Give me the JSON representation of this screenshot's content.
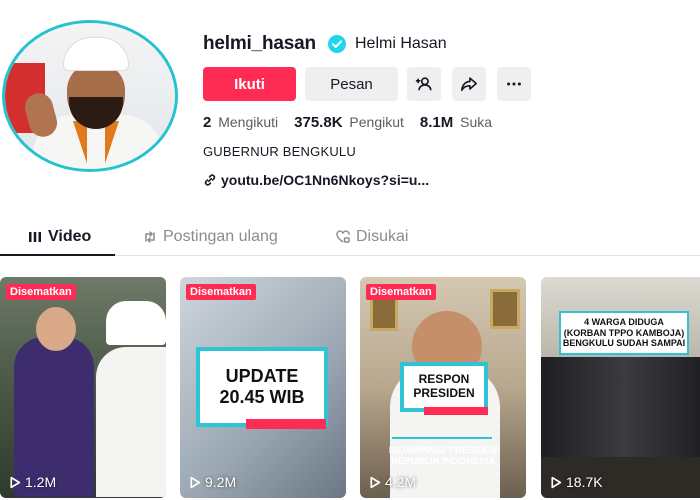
{
  "profile": {
    "username": "helmi_hasan",
    "nickname": "Helmi Hasan",
    "follow_label": "Ikuti",
    "message_label": "Pesan",
    "stats": [
      {
        "value": "2",
        "label": "Mengikuti"
      },
      {
        "value": "375.8K",
        "label": "Pengikut"
      },
      {
        "value": "8.1M",
        "label": "Suka"
      }
    ],
    "bio": "GUBERNUR BENGKULU",
    "link": "youtu.be/OC1Nn6Nkoys?si=u..."
  },
  "tabs": [
    {
      "label": "Video",
      "icon": "grid-icon",
      "active": true
    },
    {
      "label": "Postingan ulang",
      "icon": "repost-icon",
      "active": false
    },
    {
      "label": "Disukai",
      "icon": "heart-icon",
      "active": false
    }
  ],
  "videos": [
    {
      "pinned_label": "Disematkan",
      "views": "1.2M"
    },
    {
      "pinned_label": "Disematkan",
      "views": "9.2M",
      "overlay": "UPDATE\n20.45 WIB"
    },
    {
      "pinned_label": "Disematkan",
      "views": "4.2M",
      "overlay": "RESPON\nPRESIDEN",
      "caption": "DIDAMPINGI PRESIDEN\nREPUBLIK INDONESIA"
    },
    {
      "views": "18.7K",
      "overlay": "4 WARGA DIDUGA\n(KORBAN TPPO KAMBOJA)\nBENGKULU SUDAH SAMPAI"
    }
  ],
  "colors": {
    "accent": "#fe2c55",
    "verified": "#20d5ec",
    "avatar_ring": "#25c2cf",
    "button_bg": "#efeff0"
  }
}
